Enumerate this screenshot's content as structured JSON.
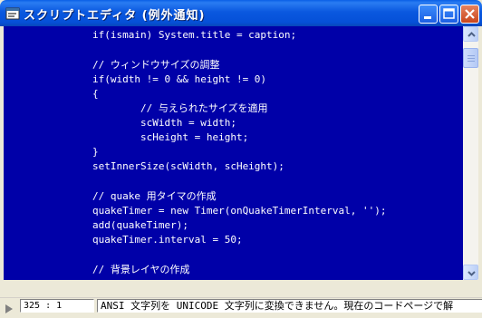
{
  "window": {
    "title": "スクリプトエディタ (例外通知)",
    "icons": [
      "app-icon",
      "minimize-icon",
      "maximize-icon",
      "close-icon"
    ]
  },
  "editor": {
    "lines": [
      "if(ismain) System.title = caption;",
      "",
      "// ウィンドウサイズの調整",
      "if(width != 0 && height != 0)",
      "{",
      "        // 与えられたサイズを適用",
      "        scWidth = width;",
      "        scHeight = height;",
      "}",
      "setInnerSize(scWidth, scHeight);",
      "",
      "// quake 用タイマの作成",
      "quakeTimer = new Timer(onQuakeTimerInterval, '');",
      "add(quakeTimer);",
      "quakeTimer.interval = 50;",
      "",
      "// 背景レイヤの作成"
    ]
  },
  "status": {
    "position": "325 : 1",
    "message": "ANSI 文字列を UNICODE 文字列に変換できません。現在のコードページで解"
  },
  "colors": {
    "editor_bg": "#0000a8",
    "editor_text": "#ffffff",
    "titlebar": "#0a58df"
  }
}
